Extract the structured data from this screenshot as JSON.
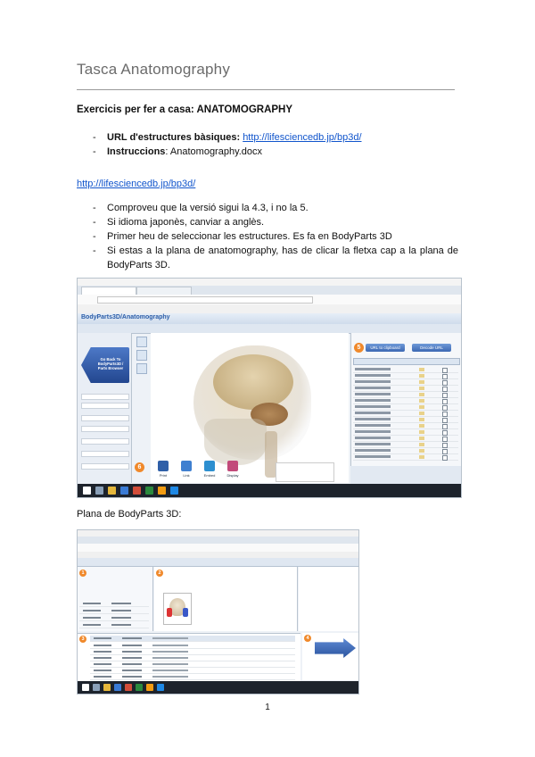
{
  "document": {
    "title": "Tasca Anatomography",
    "section_heading": "Exercicis per fer a casa: ANATOMOGRAPHY",
    "resources": [
      {
        "label": "URL d'estructures bàsiques:",
        "link": "http://lifesciencedb.jp/bp3d/"
      },
      {
        "label": "Instruccions",
        "suffix": ": Anatomography.docx"
      }
    ],
    "url": "http://lifesciencedb.jp/bp3d/",
    "instructions": [
      "Comproveu que la versió sigui la 4.3, i no la 5.",
      "Si idioma japonès, canviar a anglès.",
      "Primer heu de seleccionar les estructures. Es fa en BodyParts 3D",
      "Si estas a la plana de anatomography, has de clicar la fletxa cap a la plana de BodyParts 3D."
    ],
    "caption": "Plana de BodyParts 3D:",
    "page_number": "1"
  },
  "screenshot1": {
    "app_title": "BodyParts3D/Anatomography",
    "back_button": "Go Back To BodyParts3D / Parts Browser",
    "url_buttons": [
      "URL to clipboard",
      "Decode URL"
    ],
    "tools": [
      "Print",
      "Link",
      "Embed",
      "Display"
    ],
    "badges": [
      "5",
      "6"
    ]
  },
  "screenshot2": {
    "badges": [
      "1",
      "2",
      "3",
      "4"
    ]
  },
  "colors": {
    "link": "#1155cc",
    "title_gray": "#6b6b6b",
    "badge_orange": "#f0892b",
    "accent_blue": "#2c55a0"
  }
}
